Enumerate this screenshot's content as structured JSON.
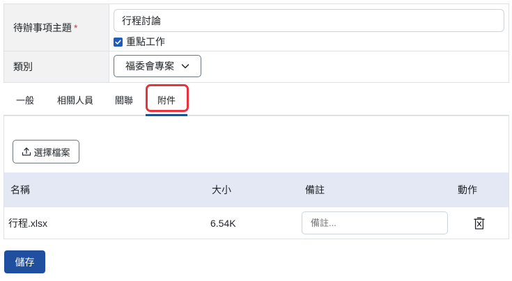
{
  "form": {
    "subject_label": "待辦事項主題",
    "required_mark": "*",
    "subject_value": "行程討論",
    "important_label": "重點工作",
    "important_checked": true,
    "category_label": "類別",
    "category_value": "福委會專案"
  },
  "tabs": [
    {
      "label": "一般"
    },
    {
      "label": "相關人員"
    },
    {
      "label": "關聯"
    },
    {
      "label": "附件",
      "active": true
    }
  ],
  "attachments": {
    "upload_label": "選擇檔案",
    "columns": {
      "name": "名稱",
      "size": "大小",
      "note": "備註",
      "action": "動作"
    },
    "rows": [
      {
        "name": "行程.xlsx",
        "size": "6.54K",
        "note_placeholder": "備註..."
      }
    ]
  },
  "footer": {
    "save_label": "儲存"
  },
  "colors": {
    "primary": "#1f4f9e",
    "highlight": "#e8333c",
    "checkbox": "#1f5eb8",
    "table_header": "#e3e8f4"
  }
}
